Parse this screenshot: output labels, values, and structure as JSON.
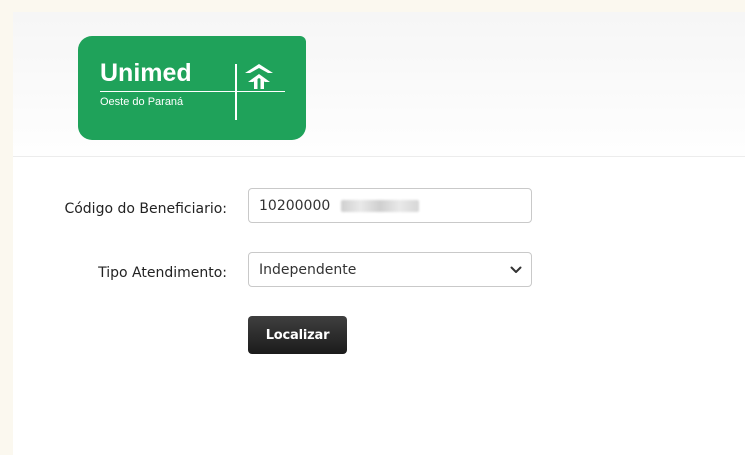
{
  "logo": {
    "brand": "Unimed",
    "subtitle": "Oeste do Paraná"
  },
  "form": {
    "beneficiary_code": {
      "label": "Código do Beneficiario:",
      "value": "10200000"
    },
    "service_type": {
      "label": "Tipo Atendimento:",
      "selected": "Independente"
    },
    "search_button_label": "Localizar"
  },
  "colors": {
    "brand_green": "#1fa25a",
    "button_dark": "#2a2a2a",
    "outer_background": "#fbf8ef"
  },
  "icons": {
    "logo_mark": "unimed-tree-icon",
    "select_arrow": "chevron-down-icon"
  }
}
